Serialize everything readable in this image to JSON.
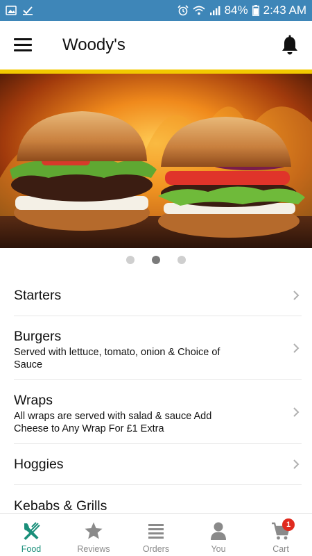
{
  "status_bar": {
    "battery": "84%",
    "time": "2:43 AM",
    "icons": [
      "image-icon",
      "check-icon",
      "alarm-icon",
      "wifi-icon",
      "signal-icon",
      "battery-icon"
    ]
  },
  "header": {
    "title": "Woody's",
    "menu_icon": "hamburger-icon",
    "notification_icon": "bell-icon"
  },
  "colors": {
    "status_bar": "#3e86b8",
    "accent_bar": "#f2c900",
    "active_nav": "#1a8f7a",
    "badge": "#e02b1f"
  },
  "carousel": {
    "slides": 3,
    "active_index": 1
  },
  "menu": {
    "items": [
      {
        "label": "Starters",
        "description": ""
      },
      {
        "label": "Burgers",
        "description": "Served with lettuce, tomato, onion & Choice of Sauce"
      },
      {
        "label": "Wraps",
        "description": "All wraps are served with salad & sauce Add Cheese to Any Wrap For £1 Extra"
      },
      {
        "label": "Hoggies",
        "description": ""
      },
      {
        "label": "Kebabs & Grills",
        "description": ""
      }
    ]
  },
  "bottom_nav": {
    "items": [
      {
        "label": "Food",
        "icon": "fork-knife-icon",
        "active": true
      },
      {
        "label": "Reviews",
        "icon": "star-icon",
        "active": false
      },
      {
        "label": "Orders",
        "icon": "list-icon",
        "active": false
      },
      {
        "label": "You",
        "icon": "person-icon",
        "active": false
      },
      {
        "label": "Cart",
        "icon": "cart-icon",
        "active": false,
        "badge": "1"
      }
    ]
  }
}
